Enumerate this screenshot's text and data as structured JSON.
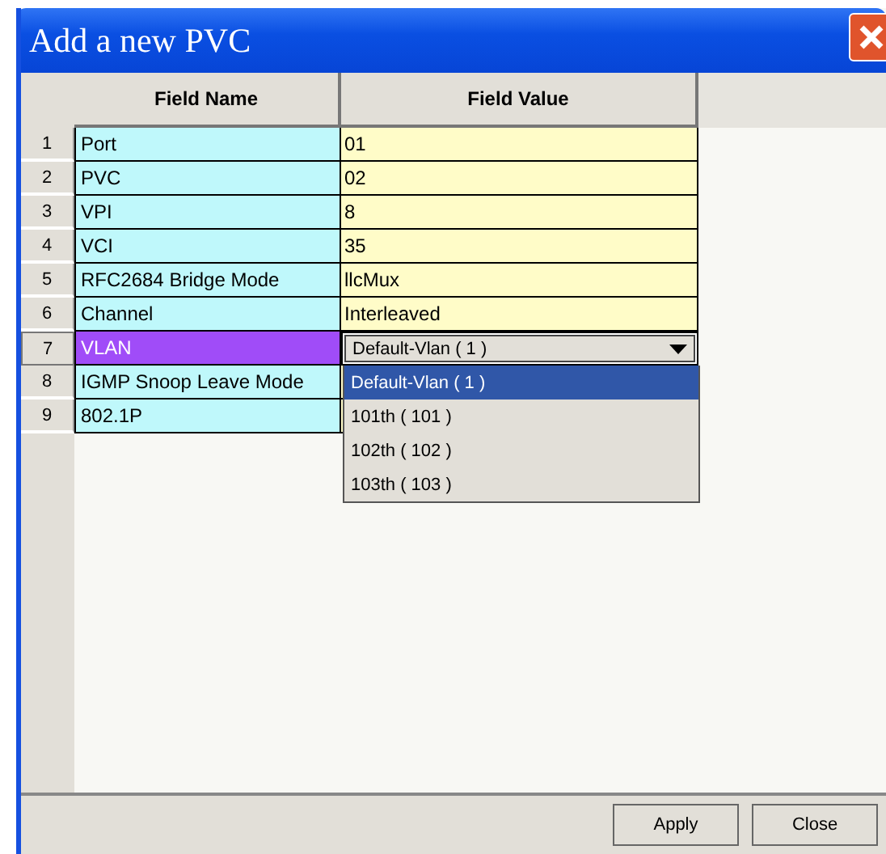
{
  "window": {
    "title": "Add a new PVC"
  },
  "table": {
    "columns": [
      "Field Name",
      "Field Value"
    ],
    "rows": [
      {
        "number": "1",
        "name": "Port",
        "kind": "text",
        "value": "01",
        "selected": false
      },
      {
        "number": "2",
        "name": "PVC",
        "kind": "text",
        "value": "02",
        "selected": false
      },
      {
        "number": "3",
        "name": "VPI",
        "kind": "text",
        "value": "8",
        "selected": false
      },
      {
        "number": "4",
        "name": "VCI",
        "kind": "text",
        "value": "35",
        "selected": false
      },
      {
        "number": "5",
        "name": "RFC2684 Bridge Mode",
        "kind": "text",
        "value": "llcMux",
        "selected": false
      },
      {
        "number": "6",
        "name": "Channel",
        "kind": "text",
        "value": "Interleaved",
        "selected": false
      },
      {
        "number": "7",
        "name": "VLAN",
        "kind": "combo",
        "value": "Default-Vlan ( 1 )",
        "selected": true,
        "expanded": true,
        "options": [
          {
            "label": "Default-Vlan ( 1 )",
            "selected": true
          },
          {
            "label": "101th ( 101 )",
            "selected": false
          },
          {
            "label": "102th ( 102 )",
            "selected": false
          },
          {
            "label": "103th ( 103 )",
            "selected": false
          }
        ]
      },
      {
        "number": "8",
        "name": "IGMP Snoop Leave Mode",
        "kind": "text",
        "selected": false
      },
      {
        "number": "9",
        "name": "802.1P",
        "kind": "text",
        "selected": false
      }
    ]
  },
  "buttons": [
    "Apply",
    "Close"
  ]
}
